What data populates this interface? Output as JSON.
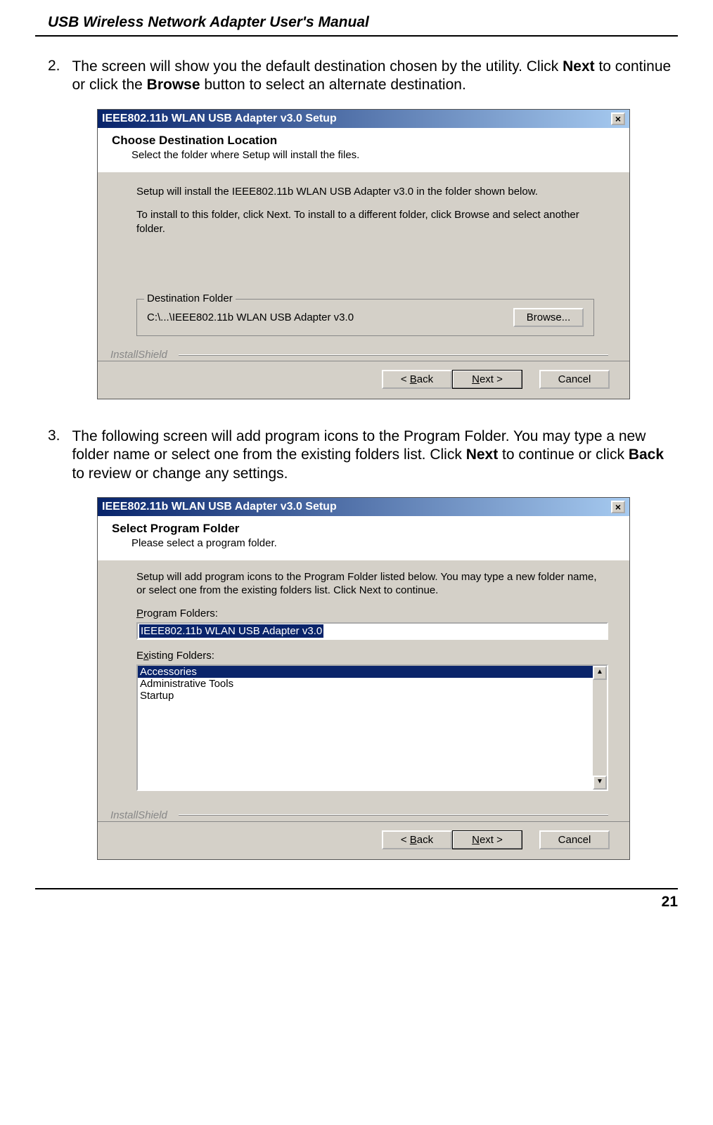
{
  "header": "USB Wireless Network Adapter User's Manual",
  "steps": {
    "s2": {
      "num": "2.",
      "pre": "The screen will show you the default destination chosen by the utility. Click ",
      "b1": "Next",
      "mid": " to continue or click the ",
      "b2": "Browse",
      "post": " button to select an alternate destination."
    },
    "s3": {
      "num": "3.",
      "pre": "The following screen will add program icons to the Program Folder. You may type a new folder name or select one from the existing folders list. Click ",
      "b1": "Next",
      "mid": " to continue or click ",
      "b2": "Back",
      "post": " to review or change any settings."
    }
  },
  "dlg1": {
    "title": "IEEE802.11b WLAN USB Adapter v3.0 Setup",
    "close": "×",
    "wh_title": "Choose Destination Location",
    "wh_sub": "Select the folder where Setup will install the files.",
    "p1": "Setup will install the IEEE802.11b WLAN USB Adapter v3.0 in the folder shown below.",
    "p2": "To install to this folder, click Next. To install to a different folder, click Browse and select another folder.",
    "legend": "Destination Folder",
    "path": "C:\\...\\IEEE802.11b WLAN USB Adapter v3.0",
    "browse": "Browse...",
    "is": "InstallShield",
    "back_pre": "< ",
    "back_u": "B",
    "back_post": "ack",
    "next_u": "N",
    "next_post": "ext >",
    "cancel": "Cancel"
  },
  "dlg2": {
    "title": "IEEE802.11b WLAN USB Adapter v3.0 Setup",
    "close": "×",
    "wh_title": "Select Program Folder",
    "wh_sub": "Please select a program folder.",
    "p1": "Setup will add program icons to the Program Folder listed below.  You may type a new folder name, or select one from the existing folders list.  Click Next to continue.",
    "lbl_pf_u": "P",
    "lbl_pf_post": "rogram Folders:",
    "pf_value": "IEEE802.11b WLAN USB Adapter v3.0",
    "lbl_ef_pre": "E",
    "lbl_ef_u": "x",
    "lbl_ef_post": "isting Folders:",
    "items": [
      "Accessories",
      "Administrative Tools",
      "Startup"
    ],
    "is": "InstallShield",
    "back_pre": "< ",
    "back_u": "B",
    "back_post": "ack",
    "next_u": "N",
    "next_post": "ext >",
    "cancel": "Cancel",
    "up": "▲",
    "down": "▼"
  },
  "page_num": "21"
}
